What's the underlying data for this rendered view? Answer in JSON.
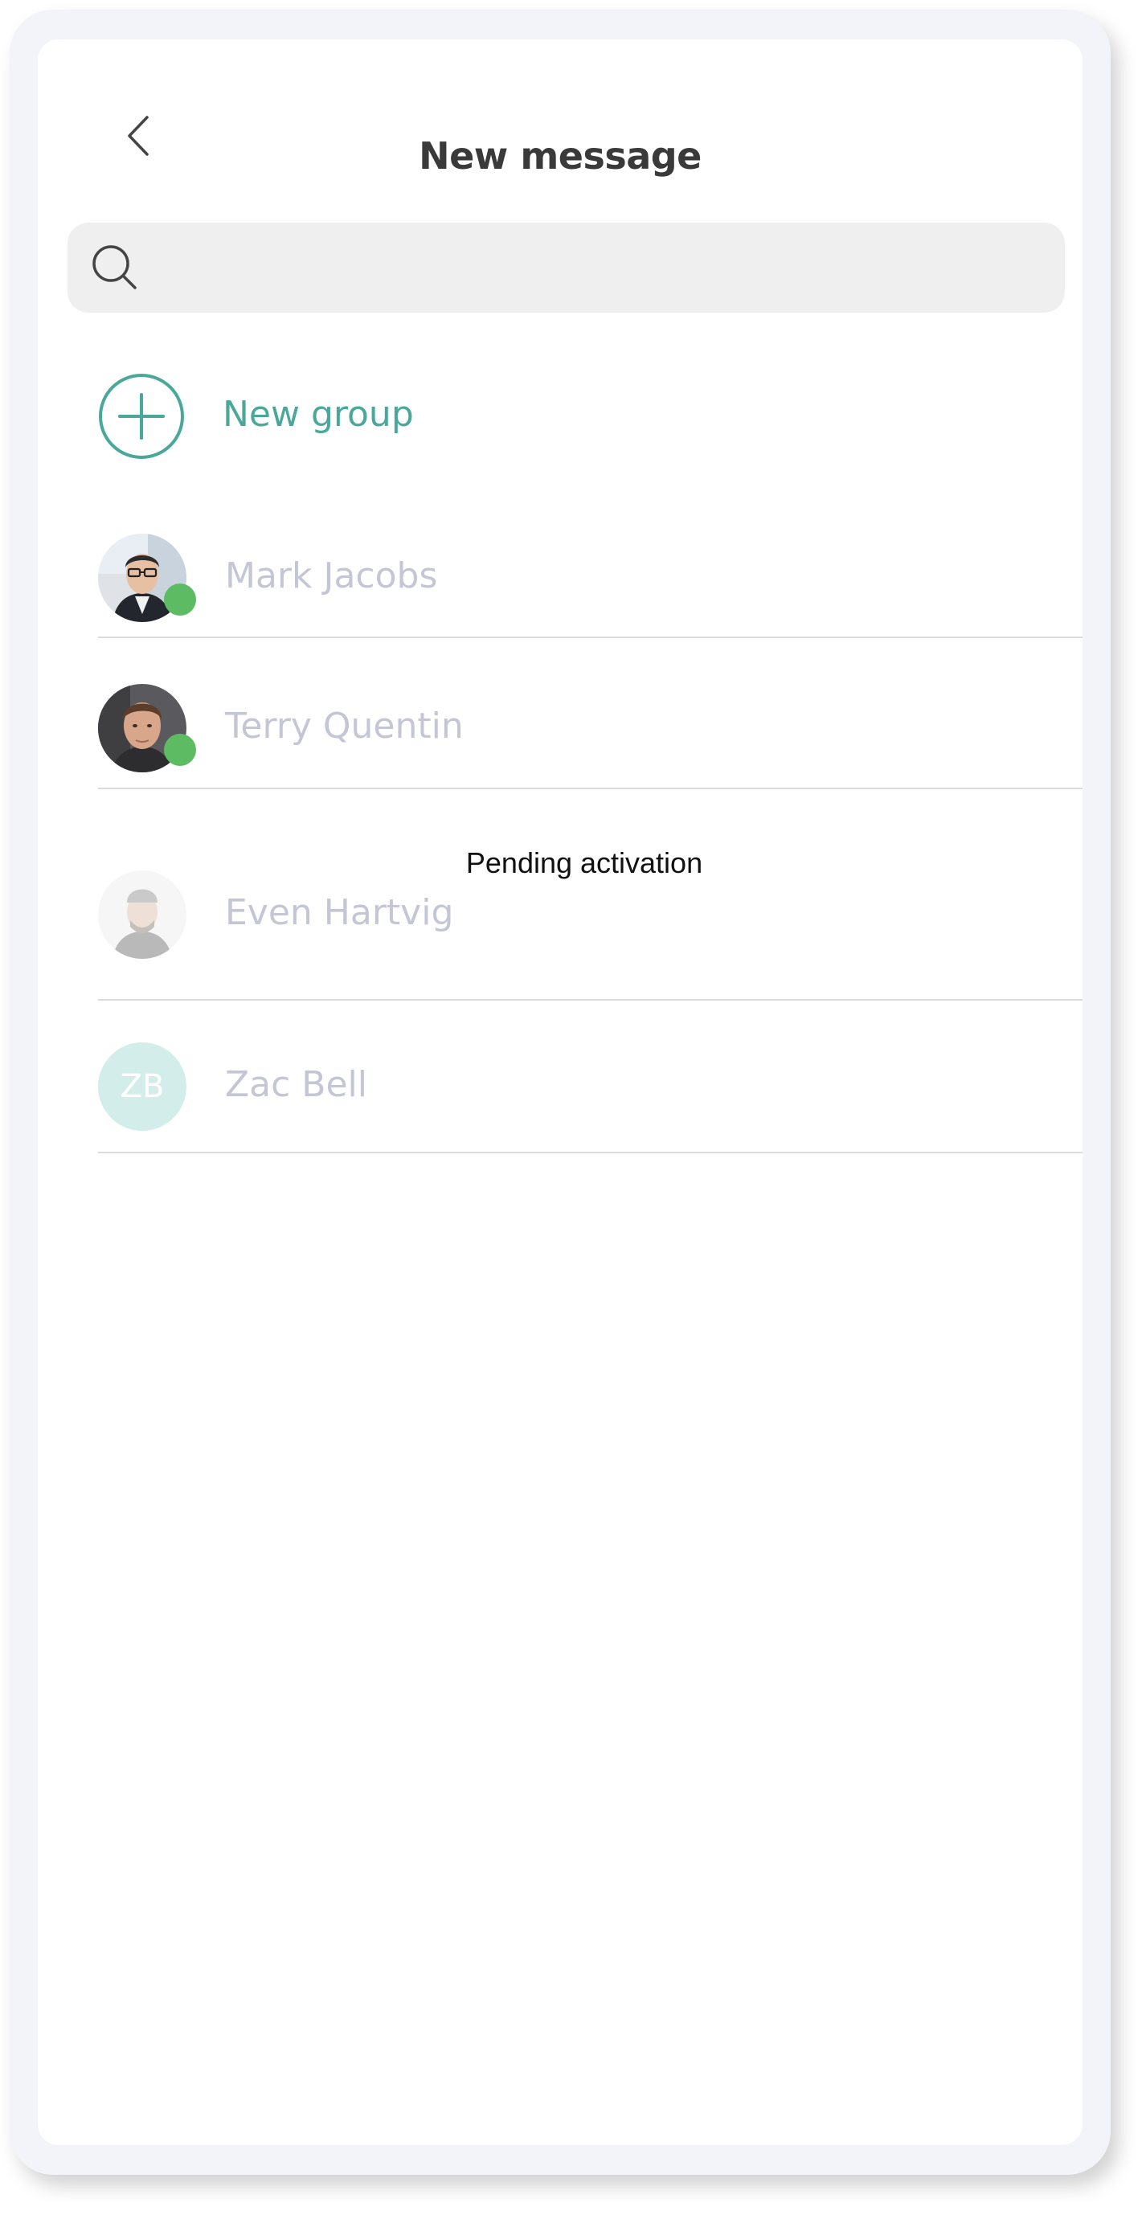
{
  "header": {
    "title": "New message",
    "back_icon": "chevron-left-icon"
  },
  "search": {
    "placeholder": "",
    "value": "",
    "icon": "search-icon"
  },
  "new_group": {
    "label": "New group",
    "icon": "plus-circle-icon",
    "color": "#4aa89b"
  },
  "contacts": [
    {
      "name": "Mark Jacobs",
      "online": true
    },
    {
      "name": "Terry Quentin",
      "online": true
    }
  ],
  "pending": {
    "label": "Pending activation",
    "contacts": [
      {
        "name": "Even Hartvig"
      },
      {
        "name": "Zac Bell",
        "initials": "ZB"
      }
    ]
  },
  "colors": {
    "accent": "#4aa89b",
    "online": "#5dbb63",
    "muted_name": "#c4c6d6",
    "initials_bg": "#d3edeb"
  }
}
